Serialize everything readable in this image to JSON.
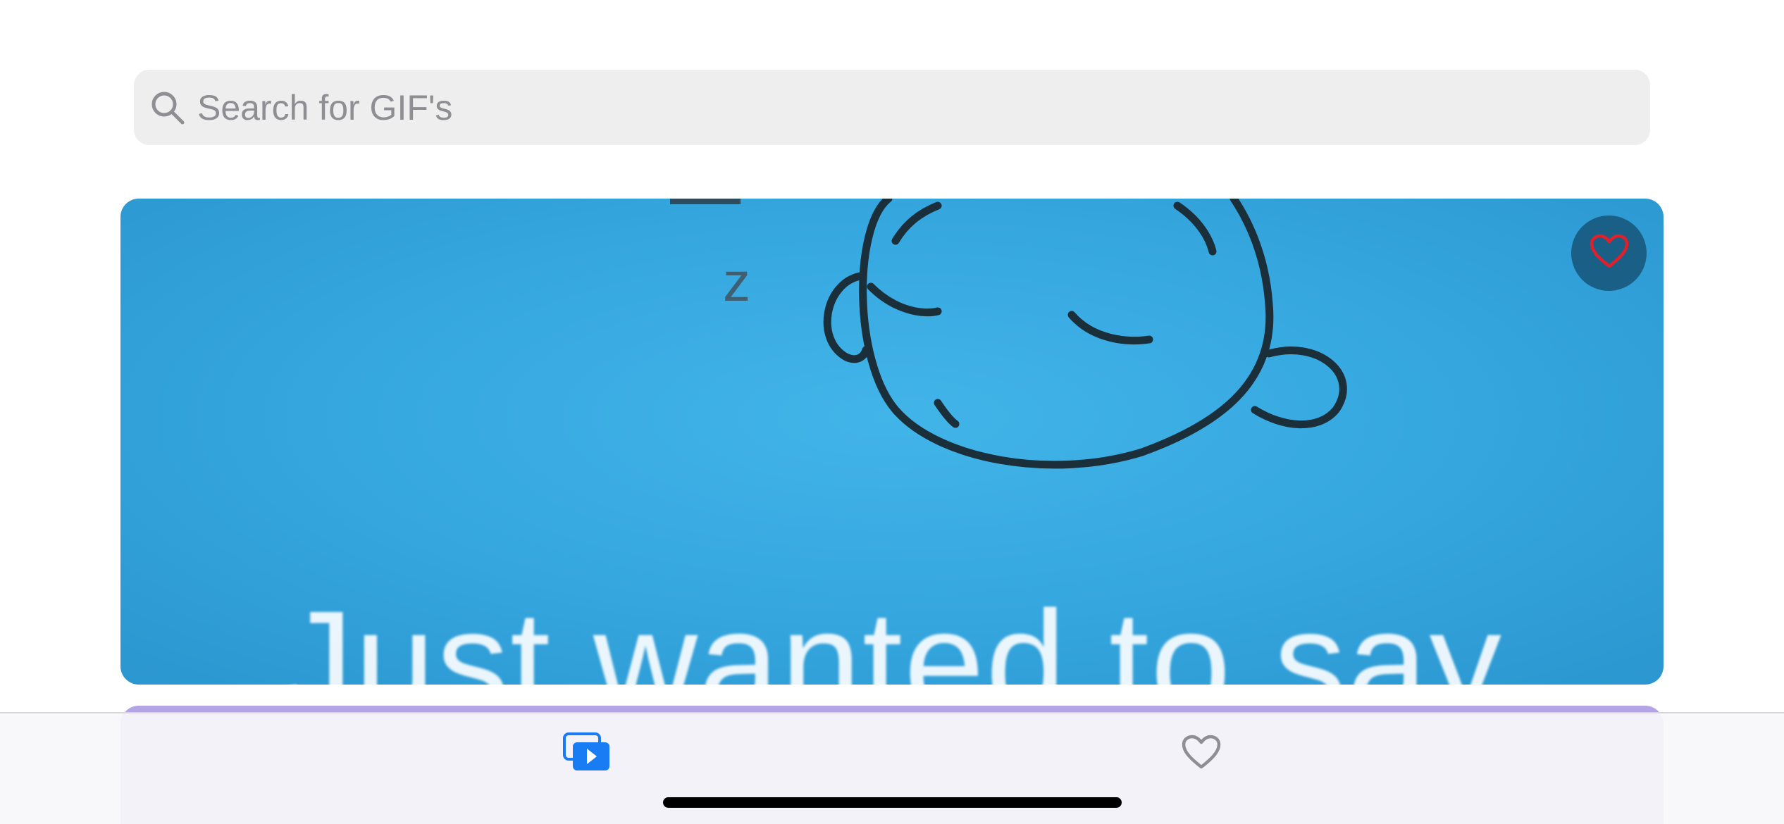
{
  "search": {
    "placeholder": "Search for GIF's",
    "value": "",
    "icon": "magnifying-glass"
  },
  "feed": {
    "items": [
      {
        "caption": "Just wanted to say",
        "favorite_icon": "heart-outline",
        "favorite_color": "#e0202a"
      }
    ]
  },
  "tab_bar": {
    "tabs": [
      {
        "icon": "gif-gallery-play",
        "selected": true,
        "color": "#1a7cf5"
      },
      {
        "icon": "heart-outline",
        "selected": false,
        "color": "#8e8e93"
      }
    ]
  },
  "colors": {
    "accent": "#1a7cf5",
    "card_background": "#37a9e1",
    "next_card_background": "#b3a4e4",
    "search_background": "#eeeeef"
  }
}
